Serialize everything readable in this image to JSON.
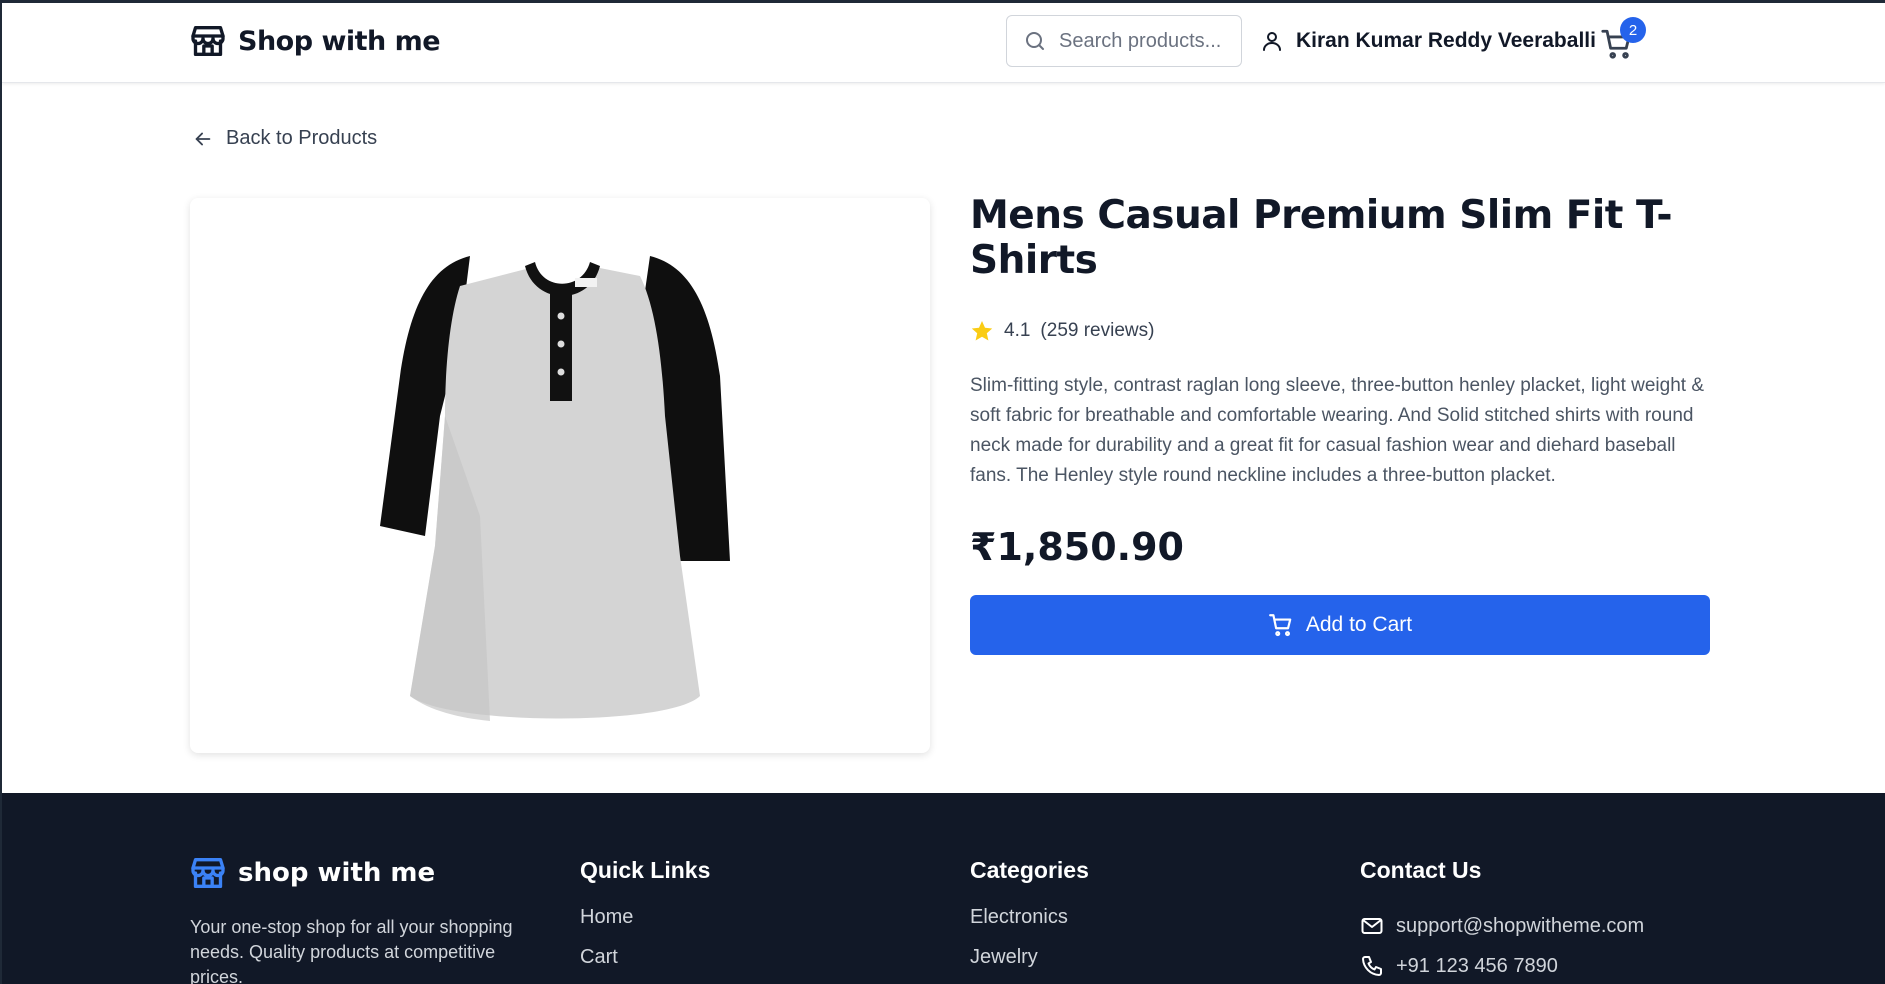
{
  "header": {
    "brand_name": "Shop with me",
    "search_placeholder": "Search products...",
    "user_name": "Kiran Kumar Reddy Veeraballi",
    "cart_count": "2"
  },
  "back_label": "Back to Products",
  "product": {
    "title": "Mens Casual Premium Slim Fit T-Shirts",
    "rating": "4.1",
    "reviews": "(259 reviews)",
    "description": "Slim-fitting style, contrast raglan long sleeve, three-button henley placket, light weight & soft fabric for breathable and comfortable wearing. And Solid stitched shirts with round neck made for durability and a great fit for casual fashion wear and diehard baseball fans. The Henley style round neckline includes a three-button placket.",
    "price": "₹1,850.90",
    "add_to_cart_label": "Add to Cart"
  },
  "footer": {
    "brand_name": "shop with me",
    "tagline": "Your one-stop shop for all your shopping needs. Quality products at competitive prices.",
    "quick_links": {
      "heading": "Quick Links",
      "items": [
        "Home",
        "Cart"
      ]
    },
    "categories": {
      "heading": "Categories",
      "items": [
        "Electronics",
        "Jewelry"
      ]
    },
    "contact": {
      "heading": "Contact Us",
      "email": "support@shopwitheme.com",
      "phone": "+91 123 456 7890"
    }
  },
  "colors": {
    "accent": "#2563eb",
    "footer_bg": "#111827",
    "star": "#facc15"
  },
  "icons": [
    "store-logo-icon",
    "search-icon",
    "user-icon",
    "cart-icon",
    "arrow-left-icon",
    "star-icon",
    "mail-icon",
    "phone-icon"
  ]
}
